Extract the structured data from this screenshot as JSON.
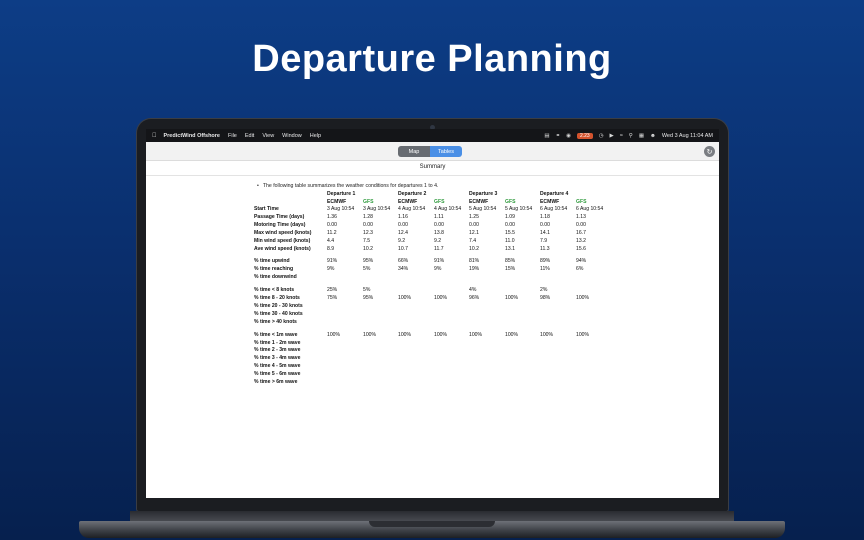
{
  "hero": {
    "title": "Departure Planning"
  },
  "menubar": {
    "app_name": "PredictWind Offshore",
    "menus": [
      "File",
      "Edit",
      "View",
      "Window",
      "Help"
    ],
    "status_badge": "2.23",
    "clock": "Wed 3 Aug  11:04 AM"
  },
  "toolbar": {
    "tabs": [
      "Map",
      "Tables"
    ],
    "selected_tab": "Tables"
  },
  "summary": {
    "title": "Summary",
    "intro": "The following table summarizes the weather conditions for departures 1 to 4."
  },
  "table": {
    "departures": [
      "Departure 1",
      "Departure 2",
      "Departure 3",
      "Departure 4"
    ],
    "models": [
      "ECMWF",
      "GFS"
    ],
    "groups": [
      {
        "rows": [
          {
            "label": "Start Time",
            "values": [
              "3 Aug 10:54",
              "3 Aug 10:54",
              "4 Aug 10:54",
              "4 Aug 10:54",
              "5 Aug 10:54",
              "5 Aug 10:54",
              "6 Aug 10:54",
              "6 Aug 10:54"
            ]
          },
          {
            "label": "Passage Time (days)",
            "values": [
              "1.36",
              "1.28",
              "1.16",
              "1.11",
              "1.25",
              "1.09",
              "1.18",
              "1.13"
            ]
          },
          {
            "label": "Motoring Time (days)",
            "values": [
              "0.00",
              "0.00",
              "0.00",
              "0.00",
              "0.00",
              "0.00",
              "0.00",
              "0.00"
            ]
          },
          {
            "label": "Max wind speed (knots)",
            "values": [
              "11.2",
              "12.3",
              "12.4",
              "13.8",
              "12.1",
              "15.5",
              "14.1",
              "16.7"
            ]
          },
          {
            "label": "Min wind speed (knots)",
            "values": [
              "4.4",
              "7.5",
              "9.2",
              "9.2",
              "7.4",
              "11.0",
              "7.9",
              "13.2"
            ]
          },
          {
            "label": "Ave wind speed (knots)",
            "values": [
              "8.9",
              "10.2",
              "10.7",
              "11.7",
              "10.2",
              "13.1",
              "11.3",
              "15.6"
            ]
          }
        ]
      },
      {
        "rows": [
          {
            "label": "% time upwind",
            "values": [
              "91%",
              "95%",
              "66%",
              "91%",
              "81%",
              "85%",
              "89%",
              "94%"
            ]
          },
          {
            "label": "% time reaching",
            "values": [
              "9%",
              "5%",
              "34%",
              "9%",
              "19%",
              "15%",
              "11%",
              "6%"
            ]
          },
          {
            "label": "% time downwind",
            "values": [
              "",
              "",
              "",
              "",
              "",
              "",
              "",
              ""
            ]
          }
        ]
      },
      {
        "rows": [
          {
            "label": "% time < 8 knots",
            "values": [
              "25%",
              "5%",
              "",
              "",
              "4%",
              "",
              "2%",
              ""
            ]
          },
          {
            "label": "% time 8 - 20 knots",
            "values": [
              "75%",
              "95%",
              "100%",
              "100%",
              "96%",
              "100%",
              "98%",
              "100%"
            ]
          },
          {
            "label": "% time 20 - 30 knots",
            "values": [
              "",
              "",
              "",
              "",
              "",
              "",
              "",
              ""
            ]
          },
          {
            "label": "% time 30 - 40 knots",
            "values": [
              "",
              "",
              "",
              "",
              "",
              "",
              "",
              ""
            ]
          },
          {
            "label": "% time > 40 knots",
            "values": [
              "",
              "",
              "",
              "",
              "",
              "",
              "",
              ""
            ]
          }
        ]
      },
      {
        "rows": [
          {
            "label": "% time < 1m wave",
            "values": [
              "100%",
              "100%",
              "100%",
              "100%",
              "100%",
              "100%",
              "100%",
              "100%"
            ]
          },
          {
            "label": "% time 1 - 2m wave",
            "values": [
              "",
              "",
              "",
              "",
              "",
              "",
              "",
              ""
            ]
          },
          {
            "label": "% time 2 - 3m wave",
            "values": [
              "",
              "",
              "",
              "",
              "",
              "",
              "",
              ""
            ]
          },
          {
            "label": "% time 3 - 4m wave",
            "values": [
              "",
              "",
              "",
              "",
              "",
              "",
              "",
              ""
            ]
          },
          {
            "label": "% time 4 - 5m wave",
            "values": [
              "",
              "",
              "",
              "",
              "",
              "",
              "",
              ""
            ]
          },
          {
            "label": "% time 5 - 6m wave",
            "values": [
              "",
              "",
              "",
              "",
              "",
              "",
              "",
              ""
            ]
          },
          {
            "label": "% time > 6m wave",
            "values": [
              "",
              "",
              "",
              "",
              "",
              "",
              "",
              ""
            ]
          }
        ]
      }
    ]
  }
}
